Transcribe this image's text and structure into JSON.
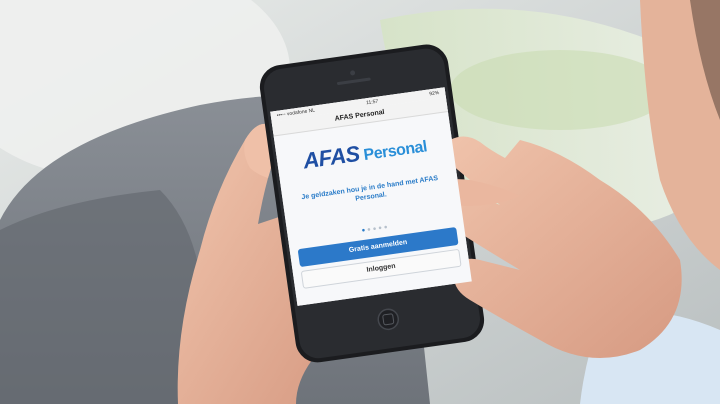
{
  "statusbar": {
    "carrier": "•••◦◦ vodafone NL",
    "time": "11:57",
    "battery": "92%"
  },
  "navbar": {
    "title": "AFAS Personal"
  },
  "logo": {
    "brand": "AFAS",
    "product": "Personal"
  },
  "tagline": "Je geldzaken hou je in de hand met AFAS Personal.",
  "pager": {
    "dots": 5,
    "active_index": 0
  },
  "buttons": {
    "signup": "Gratis aanmelden",
    "login": "Inloggen"
  },
  "colors": {
    "brand_dark_blue": "#1f4fa3",
    "brand_light_blue": "#2a8fd8",
    "button_blue": "#2c79c9"
  }
}
